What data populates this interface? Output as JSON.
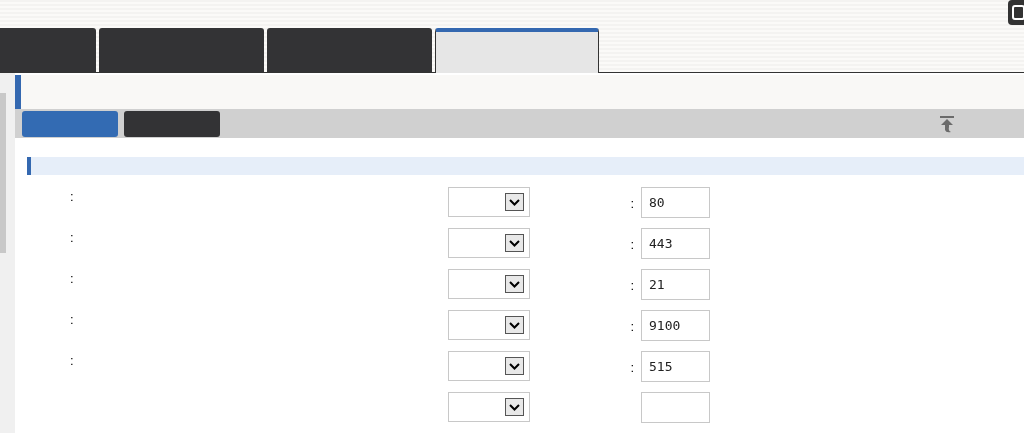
{
  "tabs": [
    {
      "selected": false
    },
    {
      "selected": false
    },
    {
      "selected": false
    },
    {
      "selected": true
    }
  ],
  "toolbar": {
    "buttons": [
      {
        "kind": "primary"
      },
      {
        "kind": "secondary"
      }
    ]
  },
  "rows": [
    {
      "label": ":",
      "port_label": ":",
      "port": "80"
    },
    {
      "label": ":",
      "port_label": ":",
      "port": "443"
    },
    {
      "label": ":",
      "port_label": ":",
      "port": "21"
    },
    {
      "label": ":",
      "port_label": ":",
      "port": "9100"
    },
    {
      "label": ":",
      "port_label": ":",
      "port": "515"
    },
    {}
  ]
}
